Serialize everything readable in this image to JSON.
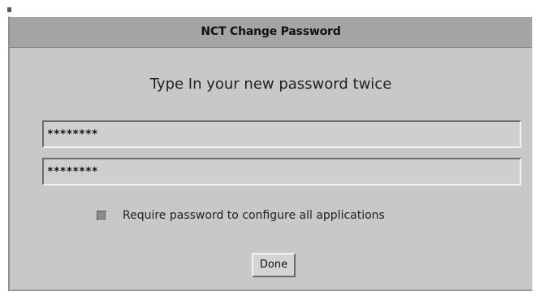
{
  "dialog": {
    "title": "NCT Change Password",
    "prompt": "Type In your new password twice",
    "password_field_1": {
      "value": "********"
    },
    "password_field_2": {
      "value": "********"
    },
    "require_checkbox": {
      "label": "Require password to configure all applications",
      "checked": true
    },
    "done_button": {
      "label": "Done"
    }
  }
}
